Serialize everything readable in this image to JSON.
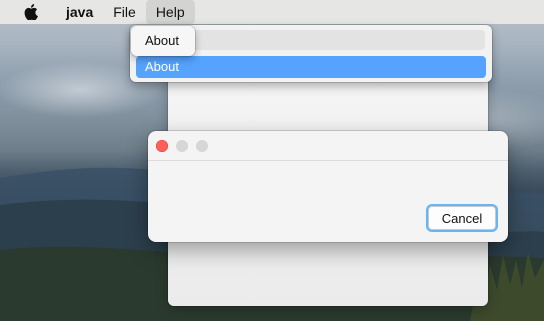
{
  "menubar": {
    "apple_icon": "apple-logo-icon",
    "app_name": "java",
    "file_label": "File",
    "help_label": "Help"
  },
  "help_menu": {
    "submenu_item": "About",
    "selected_item": "About",
    "selection_color": "#55a3ff"
  },
  "dialog": {
    "buttons": [
      "close",
      "minimize",
      "zoom"
    ],
    "close_color": "#fe5f57",
    "cancel_label": "Cancel"
  }
}
